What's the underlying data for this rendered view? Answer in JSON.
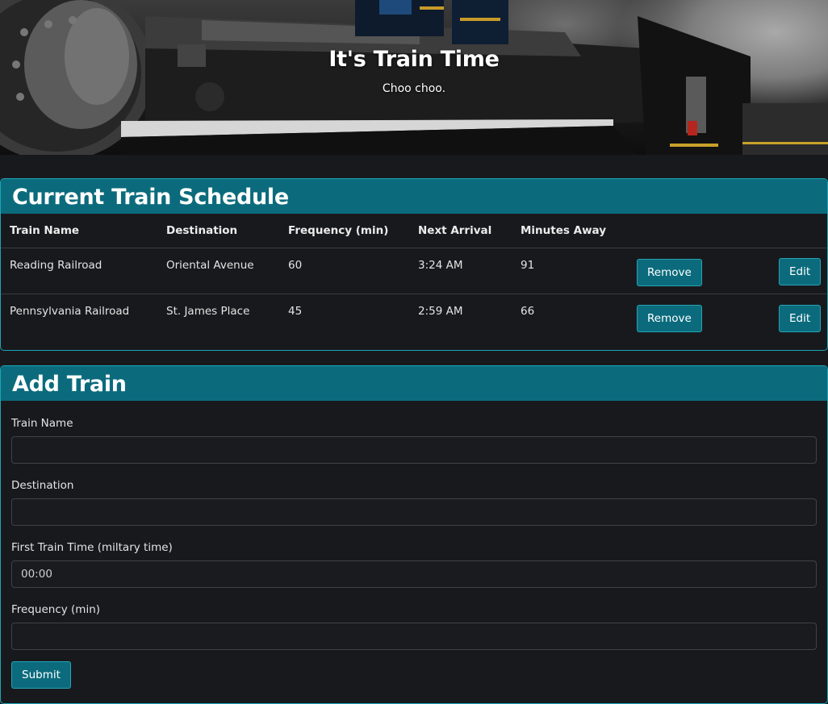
{
  "hero": {
    "title": "It's Train Time",
    "subtitle": "Choo choo."
  },
  "schedule": {
    "title": "Current Train Schedule",
    "columns": [
      "Train Name",
      "Destination",
      "Frequency (min)",
      "Next Arrival",
      "Minutes Away"
    ],
    "rows": [
      {
        "name": "Reading Railroad",
        "destination": "Oriental Avenue",
        "frequency": "60",
        "next_arrival": "3:24 AM",
        "minutes_away": "91",
        "remove_label": "Remove",
        "edit_label": "Edit"
      },
      {
        "name": "Pennsylvania Railroad",
        "destination": "St. James Place",
        "frequency": "45",
        "next_arrival": "2:59 AM",
        "minutes_away": "66",
        "remove_label": "Remove",
        "edit_label": "Edit"
      }
    ]
  },
  "add_train": {
    "title": "Add Train",
    "fields": {
      "train_name": {
        "label": "Train Name",
        "value": "",
        "placeholder": ""
      },
      "destination": {
        "label": "Destination",
        "value": "",
        "placeholder": ""
      },
      "first_time": {
        "label": "First Train Time (miltary time)",
        "value": "",
        "placeholder": "00:00"
      },
      "frequency": {
        "label": "Frequency (min)",
        "value": "",
        "placeholder": ""
      }
    },
    "submit_label": "Submit"
  },
  "colors": {
    "accent": "#0b6b7c",
    "accent_border": "#1aa6b7",
    "background": "#18191d"
  }
}
